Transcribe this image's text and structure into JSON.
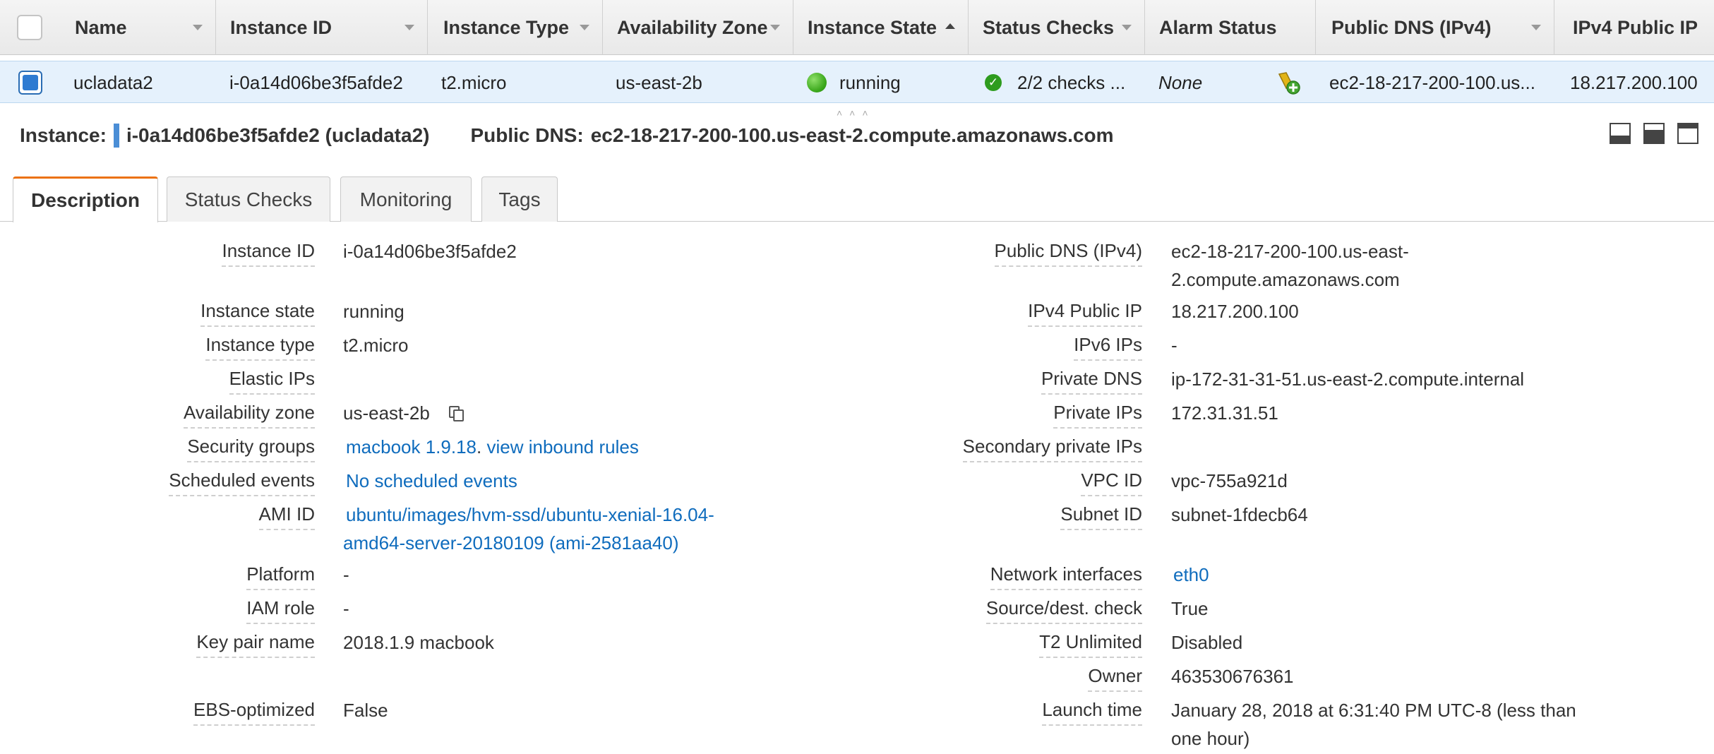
{
  "table": {
    "columns": [
      {
        "label": "Name"
      },
      {
        "label": "Instance ID"
      },
      {
        "label": "Instance Type"
      },
      {
        "label": "Availability Zone"
      },
      {
        "label": "Instance State"
      },
      {
        "label": "Status Checks"
      },
      {
        "label": "Alarm Status"
      },
      {
        "label": "Public DNS (IPv4)"
      },
      {
        "label": "IPv4 Public IP"
      }
    ],
    "row": {
      "name": "ucladata2",
      "instance_id": "i-0a14d06be3f5afde2",
      "instance_type": "t2.micro",
      "availability_zone": "us-east-2b",
      "instance_state": "running",
      "status_checks": "2/2 checks ...",
      "alarm_status": "None",
      "public_dns": "ec2-18-217-200-100.us...",
      "public_ip": "18.217.200.100"
    }
  },
  "detail": {
    "instance_label": "Instance:",
    "instance_value": "i-0a14d06be3f5afde2 (ucladata2)",
    "dns_label": "Public DNS:",
    "dns_value": "ec2-18-217-200-100.us-east-2.compute.amazonaws.com"
  },
  "tabs": [
    "Description",
    "Status Checks",
    "Monitoring",
    "Tags"
  ],
  "left": {
    "instance_id": {
      "label": "Instance ID",
      "value": "i-0a14d06be3f5afde2"
    },
    "instance_state": {
      "label": "Instance state",
      "value": "running"
    },
    "instance_type": {
      "label": "Instance type",
      "value": "t2.micro"
    },
    "elastic_ips": {
      "label": "Elastic IPs",
      "value": ""
    },
    "availability_zone": {
      "label": "Availability zone",
      "value": "us-east-2b"
    },
    "security_groups": {
      "label": "Security groups",
      "group": "macbook 1.9.18",
      "sep": ".",
      "rules_link": "view inbound rules"
    },
    "scheduled_events": {
      "label": "Scheduled events",
      "value": "No scheduled events"
    },
    "ami_id": {
      "label": "AMI ID",
      "line1": "ubuntu/images/hvm-ssd/ubuntu-xenial-16.04-",
      "line2": "amd64-server-20180109 (ami-2581aa40)"
    },
    "platform": {
      "label": "Platform",
      "value": "-"
    },
    "iam_role": {
      "label": "IAM role",
      "value": "-"
    },
    "key_pair": {
      "label": "Key pair name",
      "value": "2018.1.9 macbook"
    },
    "ebs_optimized": {
      "label": "EBS-optimized",
      "value": "False"
    }
  },
  "right": {
    "public_dns": {
      "label": "Public DNS (IPv4)",
      "line1": "ec2-18-217-200-100.us-east-",
      "line2": "2.compute.amazonaws.com"
    },
    "public_ip": {
      "label": "IPv4 Public IP",
      "value": "18.217.200.100"
    },
    "ipv6": {
      "label": "IPv6 IPs",
      "value": "-"
    },
    "private_dns": {
      "label": "Private DNS",
      "value": "ip-172-31-31-51.us-east-2.compute.internal"
    },
    "private_ips": {
      "label": "Private IPs",
      "value": "172.31.31.51"
    },
    "secondary_private_ips": {
      "label": "Secondary private IPs",
      "value": ""
    },
    "vpc_id": {
      "label": "VPC ID",
      "value": "vpc-755a921d"
    },
    "subnet_id": {
      "label": "Subnet ID",
      "value": "subnet-1fdecb64"
    },
    "network_interfaces": {
      "label": "Network interfaces",
      "value": "eth0"
    },
    "source_dest_check": {
      "label": "Source/dest. check",
      "value": "True"
    },
    "t2_unlimited": {
      "label": "T2 Unlimited",
      "value": "Disabled"
    },
    "owner": {
      "label": "Owner",
      "value": "463530676361"
    },
    "launch_time": {
      "label": "Launch time",
      "line1": "January 28, 2018 at 6:31:40 PM UTC-8 (less than",
      "line2": "one hour)"
    }
  },
  "colors": {
    "accent_tab": "#ec7211",
    "link": "#0f6cbd",
    "selected_row": "#e5f1fc",
    "running": "#3aa71b"
  },
  "icons": [
    "checkbox-icon",
    "sort-caret-icon",
    "running-status-icon",
    "check-passed-icon",
    "alarm-add-icon",
    "copy-icon",
    "pane-bottom-icon",
    "pane-middle-icon",
    "pane-top-icon",
    "resize-grip-icon"
  ]
}
